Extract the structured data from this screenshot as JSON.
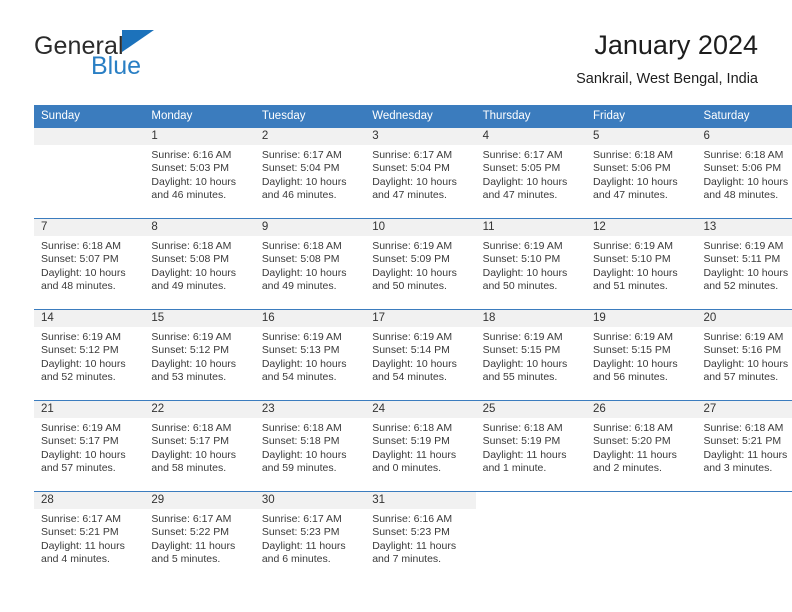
{
  "brand": {
    "name_part1": "General",
    "name_part2": "Blue",
    "accent_color": "#2a7fc4",
    "triangle_color": "#1c72bb",
    "triangle_icon": "triangle-icon"
  },
  "header": {
    "title": "January 2024",
    "location": "Sankrail, West Bengal, India"
  },
  "calendar": {
    "header_bg": "#3b7cbe",
    "daynum_bg": "#f1f1f1",
    "weekdays": [
      "Sunday",
      "Monday",
      "Tuesday",
      "Wednesday",
      "Thursday",
      "Friday",
      "Saturday"
    ],
    "weeks": [
      [
        {
          "blank": true
        },
        {
          "day": "1",
          "sunrise": "Sunrise: 6:16 AM",
          "sunset": "Sunset: 5:03 PM",
          "daylight1": "Daylight: 10 hours",
          "daylight2": "and 46 minutes."
        },
        {
          "day": "2",
          "sunrise": "Sunrise: 6:17 AM",
          "sunset": "Sunset: 5:04 PM",
          "daylight1": "Daylight: 10 hours",
          "daylight2": "and 46 minutes."
        },
        {
          "day": "3",
          "sunrise": "Sunrise: 6:17 AM",
          "sunset": "Sunset: 5:04 PM",
          "daylight1": "Daylight: 10 hours",
          "daylight2": "and 47 minutes."
        },
        {
          "day": "4",
          "sunrise": "Sunrise: 6:17 AM",
          "sunset": "Sunset: 5:05 PM",
          "daylight1": "Daylight: 10 hours",
          "daylight2": "and 47 minutes."
        },
        {
          "day": "5",
          "sunrise": "Sunrise: 6:18 AM",
          "sunset": "Sunset: 5:06 PM",
          "daylight1": "Daylight: 10 hours",
          "daylight2": "and 47 minutes."
        },
        {
          "day": "6",
          "sunrise": "Sunrise: 6:18 AM",
          "sunset": "Sunset: 5:06 PM",
          "daylight1": "Daylight: 10 hours",
          "daylight2": "and 48 minutes."
        }
      ],
      [
        {
          "day": "7",
          "sunrise": "Sunrise: 6:18 AM",
          "sunset": "Sunset: 5:07 PM",
          "daylight1": "Daylight: 10 hours",
          "daylight2": "and 48 minutes."
        },
        {
          "day": "8",
          "sunrise": "Sunrise: 6:18 AM",
          "sunset": "Sunset: 5:08 PM",
          "daylight1": "Daylight: 10 hours",
          "daylight2": "and 49 minutes."
        },
        {
          "day": "9",
          "sunrise": "Sunrise: 6:18 AM",
          "sunset": "Sunset: 5:08 PM",
          "daylight1": "Daylight: 10 hours",
          "daylight2": "and 49 minutes."
        },
        {
          "day": "10",
          "sunrise": "Sunrise: 6:19 AM",
          "sunset": "Sunset: 5:09 PM",
          "daylight1": "Daylight: 10 hours",
          "daylight2": "and 50 minutes."
        },
        {
          "day": "11",
          "sunrise": "Sunrise: 6:19 AM",
          "sunset": "Sunset: 5:10 PM",
          "daylight1": "Daylight: 10 hours",
          "daylight2": "and 50 minutes."
        },
        {
          "day": "12",
          "sunrise": "Sunrise: 6:19 AM",
          "sunset": "Sunset: 5:10 PM",
          "daylight1": "Daylight: 10 hours",
          "daylight2": "and 51 minutes."
        },
        {
          "day": "13",
          "sunrise": "Sunrise: 6:19 AM",
          "sunset": "Sunset: 5:11 PM",
          "daylight1": "Daylight: 10 hours",
          "daylight2": "and 52 minutes."
        }
      ],
      [
        {
          "day": "14",
          "sunrise": "Sunrise: 6:19 AM",
          "sunset": "Sunset: 5:12 PM",
          "daylight1": "Daylight: 10 hours",
          "daylight2": "and 52 minutes."
        },
        {
          "day": "15",
          "sunrise": "Sunrise: 6:19 AM",
          "sunset": "Sunset: 5:12 PM",
          "daylight1": "Daylight: 10 hours",
          "daylight2": "and 53 minutes."
        },
        {
          "day": "16",
          "sunrise": "Sunrise: 6:19 AM",
          "sunset": "Sunset: 5:13 PM",
          "daylight1": "Daylight: 10 hours",
          "daylight2": "and 54 minutes."
        },
        {
          "day": "17",
          "sunrise": "Sunrise: 6:19 AM",
          "sunset": "Sunset: 5:14 PM",
          "daylight1": "Daylight: 10 hours",
          "daylight2": "and 54 minutes."
        },
        {
          "day": "18",
          "sunrise": "Sunrise: 6:19 AM",
          "sunset": "Sunset: 5:15 PM",
          "daylight1": "Daylight: 10 hours",
          "daylight2": "and 55 minutes."
        },
        {
          "day": "19",
          "sunrise": "Sunrise: 6:19 AM",
          "sunset": "Sunset: 5:15 PM",
          "daylight1": "Daylight: 10 hours",
          "daylight2": "and 56 minutes."
        },
        {
          "day": "20",
          "sunrise": "Sunrise: 6:19 AM",
          "sunset": "Sunset: 5:16 PM",
          "daylight1": "Daylight: 10 hours",
          "daylight2": "and 57 minutes."
        }
      ],
      [
        {
          "day": "21",
          "sunrise": "Sunrise: 6:19 AM",
          "sunset": "Sunset: 5:17 PM",
          "daylight1": "Daylight: 10 hours",
          "daylight2": "and 57 minutes."
        },
        {
          "day": "22",
          "sunrise": "Sunrise: 6:18 AM",
          "sunset": "Sunset: 5:17 PM",
          "daylight1": "Daylight: 10 hours",
          "daylight2": "and 58 minutes."
        },
        {
          "day": "23",
          "sunrise": "Sunrise: 6:18 AM",
          "sunset": "Sunset: 5:18 PM",
          "daylight1": "Daylight: 10 hours",
          "daylight2": "and 59 minutes."
        },
        {
          "day": "24",
          "sunrise": "Sunrise: 6:18 AM",
          "sunset": "Sunset: 5:19 PM",
          "daylight1": "Daylight: 11 hours",
          "daylight2": "and 0 minutes."
        },
        {
          "day": "25",
          "sunrise": "Sunrise: 6:18 AM",
          "sunset": "Sunset: 5:19 PM",
          "daylight1": "Daylight: 11 hours",
          "daylight2": "and 1 minute."
        },
        {
          "day": "26",
          "sunrise": "Sunrise: 6:18 AM",
          "sunset": "Sunset: 5:20 PM",
          "daylight1": "Daylight: 11 hours",
          "daylight2": "and 2 minutes."
        },
        {
          "day": "27",
          "sunrise": "Sunrise: 6:18 AM",
          "sunset": "Sunset: 5:21 PM",
          "daylight1": "Daylight: 11 hours",
          "daylight2": "and 3 minutes."
        }
      ],
      [
        {
          "day": "28",
          "sunrise": "Sunrise: 6:17 AM",
          "sunset": "Sunset: 5:21 PM",
          "daylight1": "Daylight: 11 hours",
          "daylight2": "and 4 minutes."
        },
        {
          "day": "29",
          "sunrise": "Sunrise: 6:17 AM",
          "sunset": "Sunset: 5:22 PM",
          "daylight1": "Daylight: 11 hours",
          "daylight2": "and 5 minutes."
        },
        {
          "day": "30",
          "sunrise": "Sunrise: 6:17 AM",
          "sunset": "Sunset: 5:23 PM",
          "daylight1": "Daylight: 11 hours",
          "daylight2": "and 6 minutes."
        },
        {
          "day": "31",
          "sunrise": "Sunrise: 6:16 AM",
          "sunset": "Sunset: 5:23 PM",
          "daylight1": "Daylight: 11 hours",
          "daylight2": "and 7 minutes."
        },
        {
          "blank": true
        },
        {
          "blank": true
        },
        {
          "blank": true
        }
      ]
    ]
  }
}
